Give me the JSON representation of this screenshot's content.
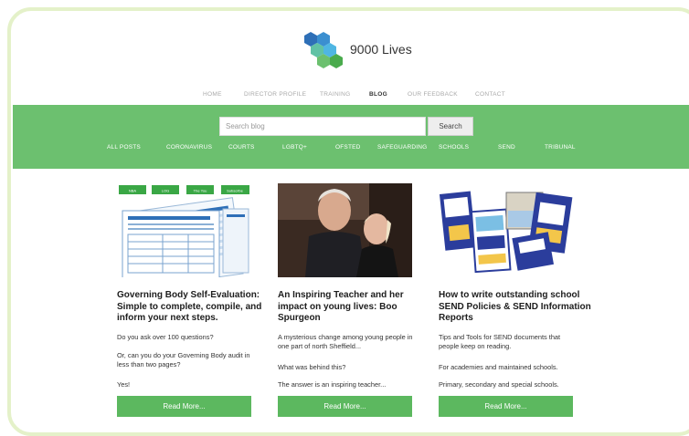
{
  "brand": {
    "name": "9000 Lives"
  },
  "nav": {
    "items": [
      {
        "label": "HOME",
        "active": false
      },
      {
        "label": "DIRECTOR PROFILE",
        "active": false
      },
      {
        "label": "TRAINING",
        "active": false
      },
      {
        "label": "BLOG",
        "active": true
      },
      {
        "label": "OUR FEEDBACK",
        "active": false
      },
      {
        "label": "CONTACT",
        "active": false
      }
    ]
  },
  "search": {
    "placeholder": "Search blog",
    "button_label": "Search"
  },
  "categories": [
    "ALL POSTS",
    "CORONAVIRUS",
    "COURTS",
    "LGBTQ+",
    "OFSTED",
    "SAFEGUARDING",
    "SCHOOLS",
    "SEND",
    "TRIBUNAL"
  ],
  "colors": {
    "band": "#6cc06f",
    "button": "#5cb85f",
    "frame": "#e4f1c9"
  },
  "posts": [
    {
      "title": "Governing Body Self-Evaluation: Simple to complete, compile, and inform your next steps.",
      "paragraphs": [
        "Do you ask over 100 questions?",
        "Or, can you do your Governing Body audit in less than two pages?",
        "Yes!"
      ],
      "image_tabs": [
        "NBA",
        "LOG",
        "The You",
        "Subscribe"
      ],
      "button_label": "Read More..."
    },
    {
      "title": "An Inspiring Teacher and her impact on young lives: Boo Spurgeon",
      "paragraphs": [
        "A mysterious change among young people in one part of north Sheffield...",
        "What was behind this?",
        "The answer is an inspiring teacher..."
      ],
      "button_label": "Read More..."
    },
    {
      "title": "How to write outstanding school SEND Policies & SEND Information Reports",
      "paragraphs": [
        "Tips and Tools for SEND documents that people keep on reading.",
        "For academies and maintained schools.",
        "Primary, secondary and special schools."
      ],
      "button_label": "Read More..."
    }
  ]
}
